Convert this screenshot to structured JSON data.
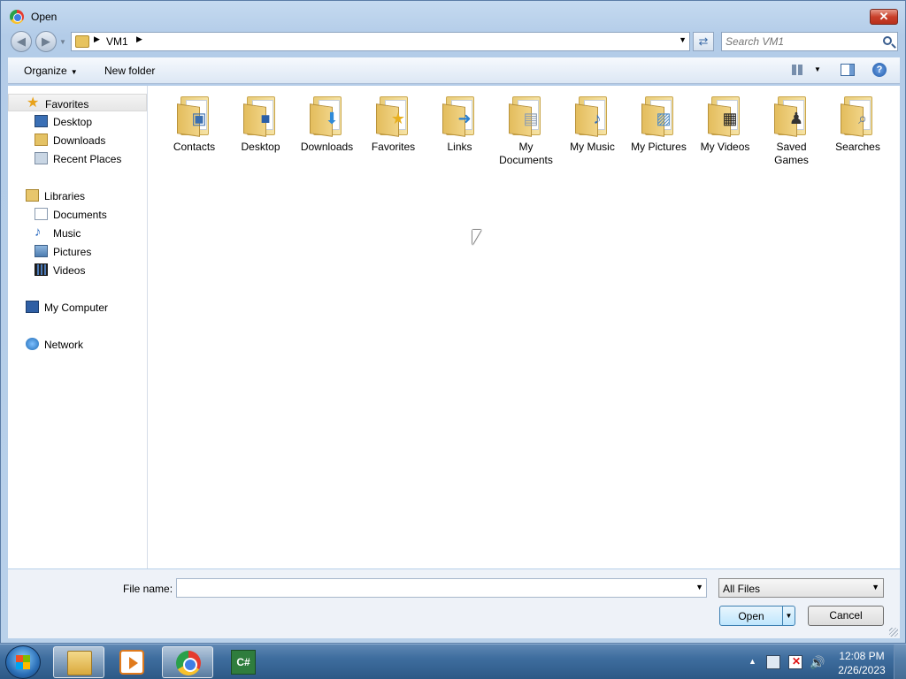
{
  "window": {
    "title": "Open"
  },
  "address": {
    "crumb": "VM1",
    "search_placeholder": "Search VM1"
  },
  "toolbar": {
    "organize_label": "Organize",
    "new_folder_label": "New folder"
  },
  "navpane": {
    "favorites": {
      "label": "Favorites",
      "items": [
        "Desktop",
        "Downloads",
        "Recent Places"
      ]
    },
    "libraries": {
      "label": "Libraries",
      "items": [
        "Documents",
        "Music",
        "Pictures",
        "Videos"
      ]
    },
    "computer": "My Computer",
    "network": "Network"
  },
  "files": [
    {
      "name": "Contacts",
      "icon": "contacts-icon"
    },
    {
      "name": "Desktop",
      "icon": "desktop-icon"
    },
    {
      "name": "Downloads",
      "icon": "downloads-icon"
    },
    {
      "name": "Favorites",
      "icon": "favorites-icon"
    },
    {
      "name": "Links",
      "icon": "links-icon"
    },
    {
      "name": "My Documents",
      "icon": "documents-icon"
    },
    {
      "name": "My Music",
      "icon": "music-icon"
    },
    {
      "name": "My Pictures",
      "icon": "pictures-icon"
    },
    {
      "name": "My Videos",
      "icon": "videos-icon"
    },
    {
      "name": "Saved Games",
      "icon": "games-icon"
    },
    {
      "name": "Searches",
      "icon": "searches-icon"
    }
  ],
  "bottom": {
    "file_name_label": "File name:",
    "file_name_value": "",
    "filter_value": "All Files",
    "open_label": "Open",
    "cancel_label": "Cancel"
  },
  "taskbar": {
    "apps": [
      "explorer-icon",
      "media-player-icon",
      "chrome-icon",
      "csharp-icon"
    ],
    "clock_time": "12:08 PM",
    "clock_date": "2/26/2023"
  }
}
